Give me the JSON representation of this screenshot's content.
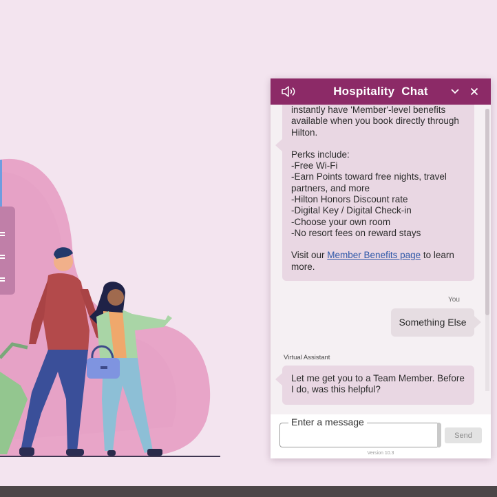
{
  "header": {
    "title": "Hospitality  Chat"
  },
  "icons": {
    "speaker": "speaker-icon",
    "minimize": "chevron-down-icon",
    "close": "close-icon"
  },
  "messages": {
    "bot1": {
      "line1": "instantly have 'Member'-level benefits available when you book directly through Hilton.",
      "perks_title": "Perks include:",
      "perks": [
        "-Free Wi-Fi",
        "-Earn Points toward free nights, travel partners, and more",
        "-Hilton Honors Discount rate",
        "-Digital Key / Digital Check-in",
        "-Choose your own room",
        "-No resort fees on reward stays"
      ],
      "visit_prefix": "Visit our ",
      "link_text": "Member Benefits page",
      "visit_suffix": " to learn more."
    },
    "you_label": "You",
    "user1": "Something Else",
    "va_label": "Virtual Assistant",
    "bot2": "Let me get you to a Team Member. Before I do, was this helpful?"
  },
  "composer": {
    "label": "Enter a message",
    "send_label": "Send",
    "version": "Version 10.3"
  },
  "colors": {
    "header": "#8c2a67",
    "bot_bubble": "#e9d7e3",
    "page_bg": "#f3e4ef",
    "bottom_bar": "#4c4648"
  }
}
